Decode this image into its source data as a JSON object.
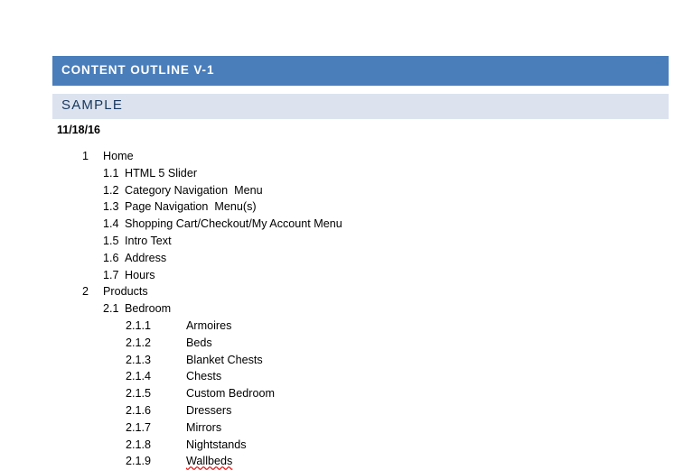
{
  "document": {
    "title": "CONTENT OUTLINE V-1",
    "section_band": "SAMPLE",
    "date": "11/18/16"
  },
  "colors": {
    "title_bar_bg": "#4a7ebb",
    "title_bar_text": "#ffffff",
    "band_bg": "#dce3ef",
    "band_text": "#17375e",
    "body_text": "#000000",
    "spellcheck_underline": "#e01b1b"
  },
  "outline": [
    {
      "level": 1,
      "number": "1",
      "label": "Home",
      "misspelled": false
    },
    {
      "level": 2,
      "number": "1.1",
      "label": "HTML 5 Slider",
      "misspelled": false
    },
    {
      "level": 2,
      "number": "1.2",
      "label": "Category Navigation  Menu",
      "misspelled": false
    },
    {
      "level": 2,
      "number": "1.3",
      "label": "Page Navigation  Menu(s)",
      "misspelled": false
    },
    {
      "level": 2,
      "number": "1.4",
      "label": "Shopping Cart/Checkout/My Account Menu",
      "misspelled": false
    },
    {
      "level": 2,
      "number": "1.5",
      "label": "Intro Text",
      "misspelled": false
    },
    {
      "level": 2,
      "number": "1.6",
      "label": "Address",
      "misspelled": false
    },
    {
      "level": 2,
      "number": "1.7",
      "label": "Hours",
      "misspelled": false
    },
    {
      "level": 1,
      "number": "2",
      "label": "Products",
      "misspelled": false
    },
    {
      "level": 2,
      "number": "2.1",
      "label": "Bedroom",
      "misspelled": false
    },
    {
      "level": 3,
      "number": "2.1.1",
      "label": "Armoires",
      "misspelled": false
    },
    {
      "level": 3,
      "number": "2.1.2",
      "label": "Beds",
      "misspelled": false
    },
    {
      "level": 3,
      "number": "2.1.3",
      "label": "Blanket Chests",
      "misspelled": false
    },
    {
      "level": 3,
      "number": "2.1.4",
      "label": "Chests",
      "misspelled": false
    },
    {
      "level": 3,
      "number": "2.1.5",
      "label": "Custom Bedroom",
      "misspelled": false
    },
    {
      "level": 3,
      "number": "2.1.6",
      "label": "Dressers",
      "misspelled": false
    },
    {
      "level": 3,
      "number": "2.1.7",
      "label": "Mirrors",
      "misspelled": false
    },
    {
      "level": 3,
      "number": "2.1.8",
      "label": "Nightstands",
      "misspelled": false
    },
    {
      "level": 3,
      "number": "2.1.9",
      "label": "Wallbeds",
      "misspelled": true
    }
  ]
}
